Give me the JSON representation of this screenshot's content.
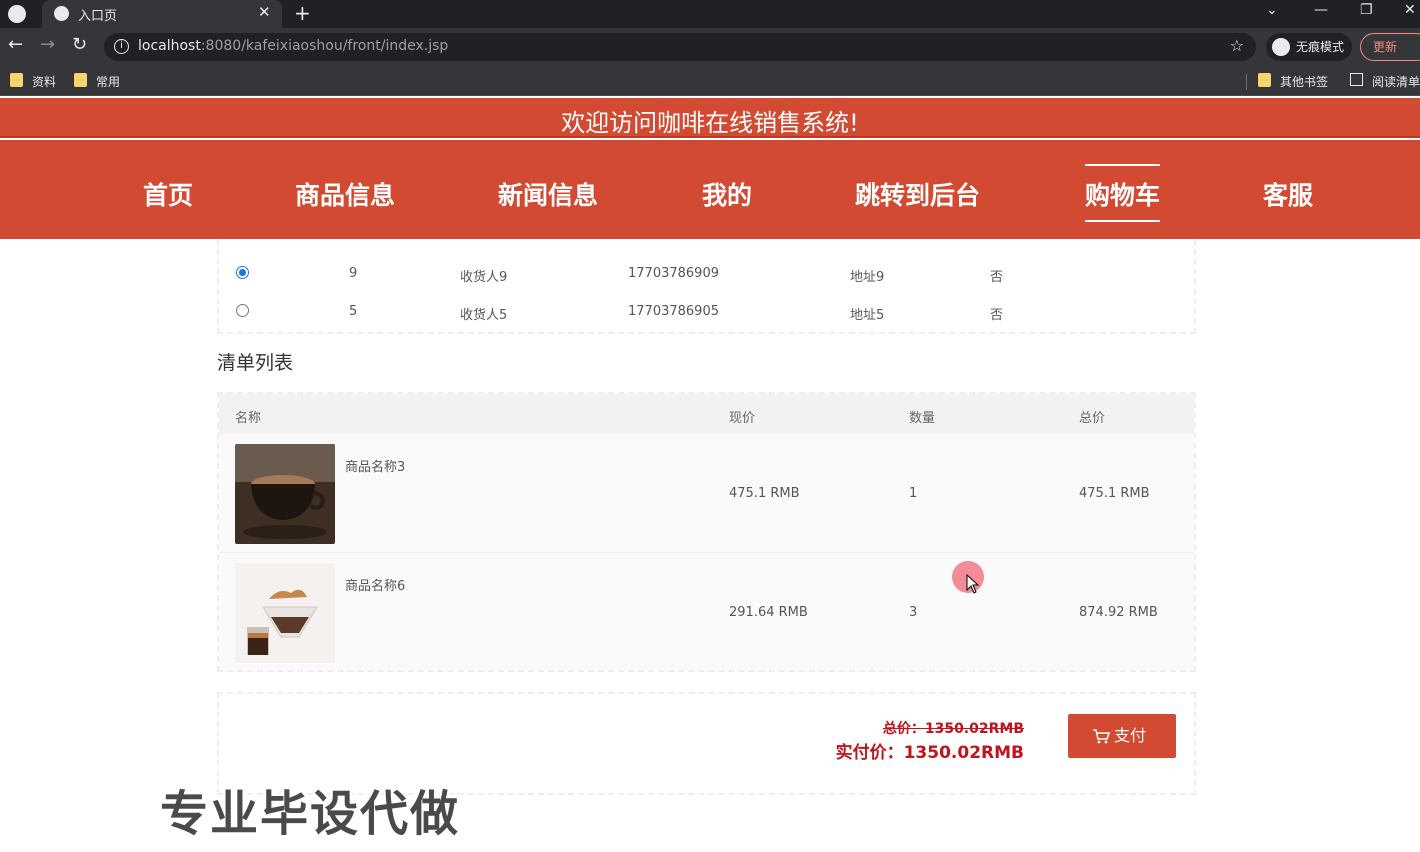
{
  "browser": {
    "tab_title": "入口页",
    "url_host": "localhost",
    "url_rest": ":8080/kafeixiaoshou/front/index.jsp",
    "incognito_label": "无痕模式",
    "update_label": "更新",
    "bookmarks": [
      "资料",
      "常用",
      "其他书签",
      "阅读清单"
    ]
  },
  "site": {
    "banner": "欢迎访问咖啡在线销售系统!",
    "nav": [
      "首页",
      "商品信息",
      "新闻信息",
      "我的",
      "跳转到后台",
      "购物车",
      "客服"
    ],
    "active_nav": "购物车"
  },
  "addresses": {
    "rows": [
      {
        "id": "9",
        "name": "收货人9",
        "phone": "17703786909",
        "address": "地址9",
        "default": "否",
        "selected": true
      },
      {
        "id": "5",
        "name": "收货人5",
        "phone": "17703786905",
        "address": "地址5",
        "default": "否",
        "selected": false
      }
    ]
  },
  "order": {
    "title": "清单列表",
    "headers": [
      "名称",
      "现价",
      "数量",
      "总价"
    ],
    "rows": [
      {
        "name": "商品名称3",
        "price": "475.1 RMB",
        "qty": "1",
        "total": "475.1 RMB"
      },
      {
        "name": "商品名称6",
        "price": "291.64 RMB",
        "qty": "3",
        "total": "874.92 RMB"
      }
    ]
  },
  "payment": {
    "old_total": "总价：1350.02RMB",
    "real_total": "实付价：1350.02RMB",
    "pay_label": "支付"
  },
  "watermark": "专业毕设代做"
}
